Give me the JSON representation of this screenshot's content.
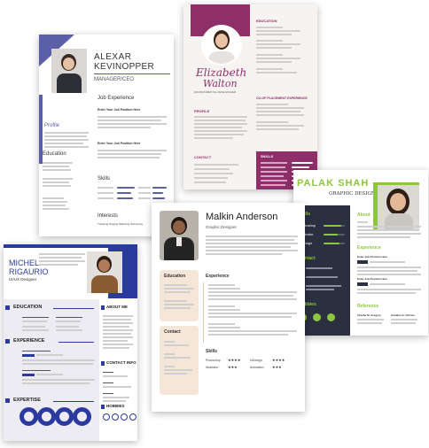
{
  "cards": {
    "alexar": {
      "name_first": "ALEXAR",
      "name_last": "KEVINOPPER",
      "role": "MANAGER/CEO",
      "job_experience_title": "Job Experience",
      "profile_title": "Profile",
      "education_title": "Education",
      "skills_title": "Skills",
      "interests_title": "Interests",
      "interests_text": "Traveling   Singing   Watching   Swimming",
      "exp_item_1": "Enter Your Job Position Here",
      "exp_item_2": "Enter Your Job Position Here",
      "accent": "#5b5fa8"
    },
    "elizabeth": {
      "name_first": "Elizabeth",
      "name_last": "Walton",
      "subtitle": "ENVIRONMENTAL RESEARCHER",
      "education_title": "EDUCATION",
      "coop_title": "CO-OP PLACEMENT EXPERIENCE",
      "profile_title": "PROFILE",
      "contact_title": "CONTACT",
      "skills_title": "SKILLS",
      "accent": "#8e2f6a"
    },
    "palak": {
      "name_first": "PALAK",
      "name_last": "SHAH",
      "role": "GRAPHIC DESIGNER",
      "skills_title": "Skills",
      "skills": [
        "Photoshop",
        "Illustrator",
        "Indesign"
      ],
      "contact_title": "Contact",
      "hobbies_title": "Hobbies",
      "about_title": "About",
      "experience_title": "Experience",
      "reference_title": "Reference",
      "exp_item_1": "Enter Job Position Here",
      "exp_item_2": "Enter Job Position Here",
      "ref_name_1": "Charlie M. Gregory",
      "ref_name_2": "Candice K. Christo",
      "accent": "#8dc63f",
      "dark": "#2b3040"
    },
    "malkin": {
      "name_first": "Malkin",
      "name_last": "Anderson",
      "role": "Graphic Designer",
      "education_title": "Education",
      "experience_title": "Experience",
      "contact_title": "Contact",
      "skills_title": "Skills",
      "skills": [
        "Photoshop",
        "InDesign",
        "Illustrator",
        "Animation"
      ],
      "accent": "#f3e3d4"
    },
    "michel": {
      "name_first": "MICHEL",
      "name_last": "RIGAURIO",
      "role": "UI/UX Designer",
      "education_title": "EDUCATION",
      "experience_title": "EXPERIENCE",
      "expertise_title": "EXPERTISE",
      "about_title": "ABOUT ME",
      "contact_title": "CONTACT INFO",
      "hobbies_title": "HOBBIES",
      "accent": "#2b3a9e"
    }
  }
}
